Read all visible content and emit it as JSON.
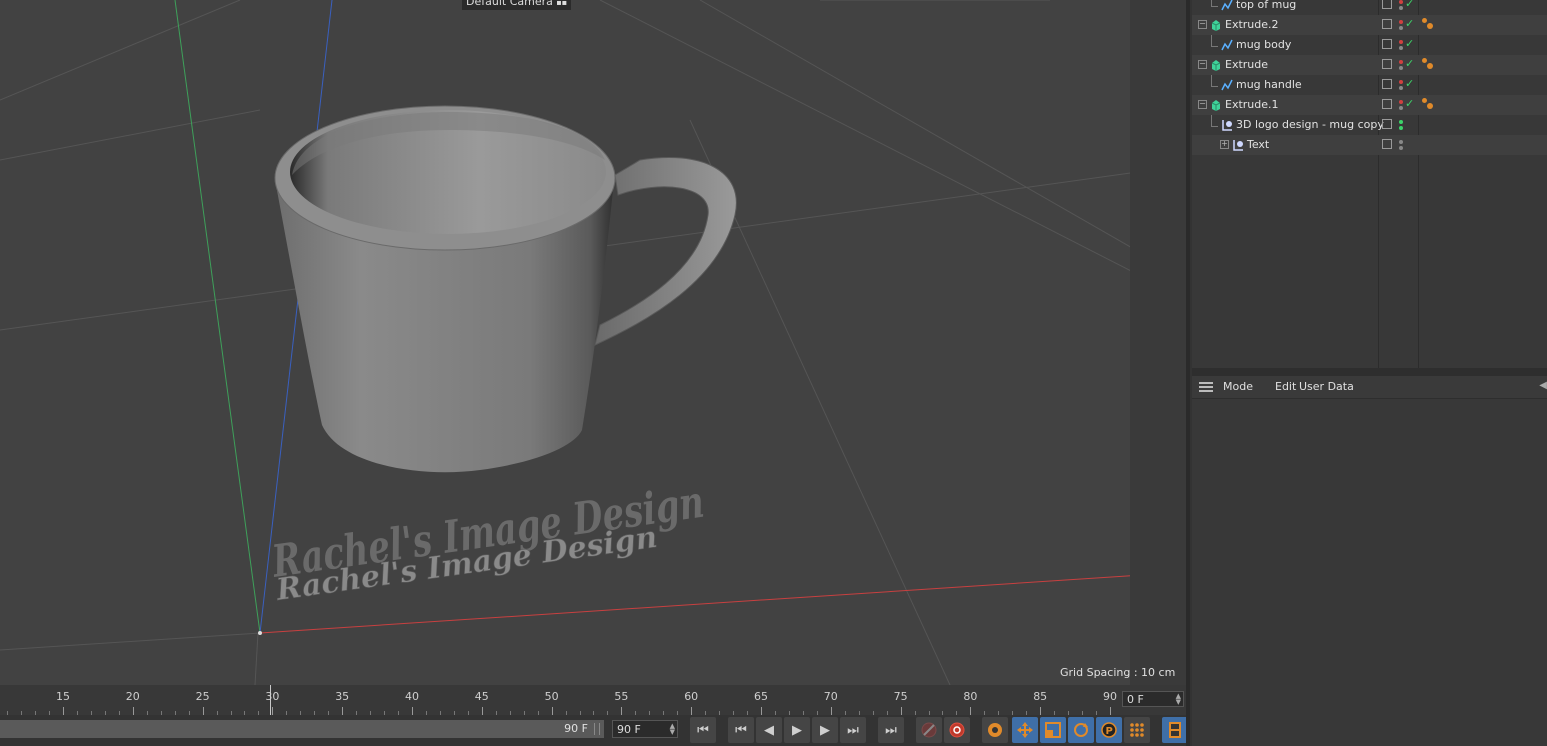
{
  "viewport": {
    "camera_label": "Default Camera",
    "grid_spacing": "Grid Spacing : 10 cm",
    "logo_text": "Rachel's Image Design"
  },
  "timeline": {
    "ticks": [
      "15",
      "20",
      "25",
      "30",
      "35",
      "40",
      "45",
      "50",
      "55",
      "60",
      "65",
      "70",
      "75",
      "80",
      "85",
      "90"
    ],
    "current_frame": "0 F"
  },
  "transport": {
    "range_end_label": "90 F",
    "end_frame": "90 F",
    "buttons": [
      "go-to-start",
      "previous-key",
      "previous-frame",
      "play",
      "next-frame",
      "next-key",
      "go-to-end",
      "record-keys",
      "auto-key",
      "key-settings",
      "move-key",
      "scale-key",
      "rotate-key",
      "param-key",
      "point-level",
      "timeline-window"
    ]
  },
  "object_manager": {
    "objects": [
      {
        "name": "top of mug",
        "type": "spline"
      },
      {
        "name": "Extrude.2",
        "type": "extrude"
      },
      {
        "name": "mug body",
        "type": "spline"
      },
      {
        "name": "Extrude",
        "type": "extrude"
      },
      {
        "name": "mug handle",
        "type": "spline"
      },
      {
        "name": "Extrude.1",
        "type": "extrude"
      },
      {
        "name": "3D logo design - mug copy",
        "type": "layer"
      },
      {
        "name": "Text",
        "type": "text"
      }
    ]
  },
  "attribute_manager": {
    "menu": [
      "Mode",
      "Edit",
      "User Data"
    ]
  },
  "colors": {
    "viewport_bg": "#424242",
    "x_axis": "#c84040",
    "y_axis": "#3ea05a",
    "z_axis": "#3a60c0",
    "extrude_icon": "#3fd39a",
    "spline_icon": "#5ab0ff",
    "tag_orange": "#e08a2a",
    "check_green": "#3dd36a"
  }
}
